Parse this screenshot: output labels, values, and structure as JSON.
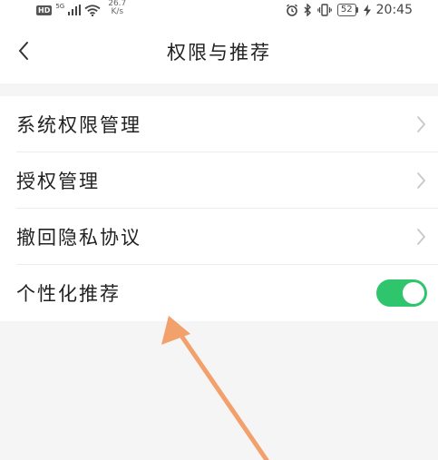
{
  "status_bar": {
    "hd_badge": "HD",
    "network_label": "5G",
    "speed_value": "26.7",
    "speed_unit": "K/s",
    "battery_level": "52",
    "time": "20:45"
  },
  "header": {
    "title": "权限与推荐",
    "back_icon": "chevron-left-icon"
  },
  "list": {
    "items": [
      {
        "label": "系统权限管理",
        "trailing": "chevron-right-icon"
      },
      {
        "label": "授权管理",
        "trailing": "chevron-right-icon"
      },
      {
        "label": "撤回隐私协议",
        "trailing": "chevron-right-icon"
      },
      {
        "label": "个性化推荐",
        "trailing": "toggle",
        "toggle_on": true
      }
    ]
  },
  "colors": {
    "toggle_on": "#2fc56d",
    "annotation_arrow": "#f2a06c",
    "background": "#f5f5f5"
  }
}
